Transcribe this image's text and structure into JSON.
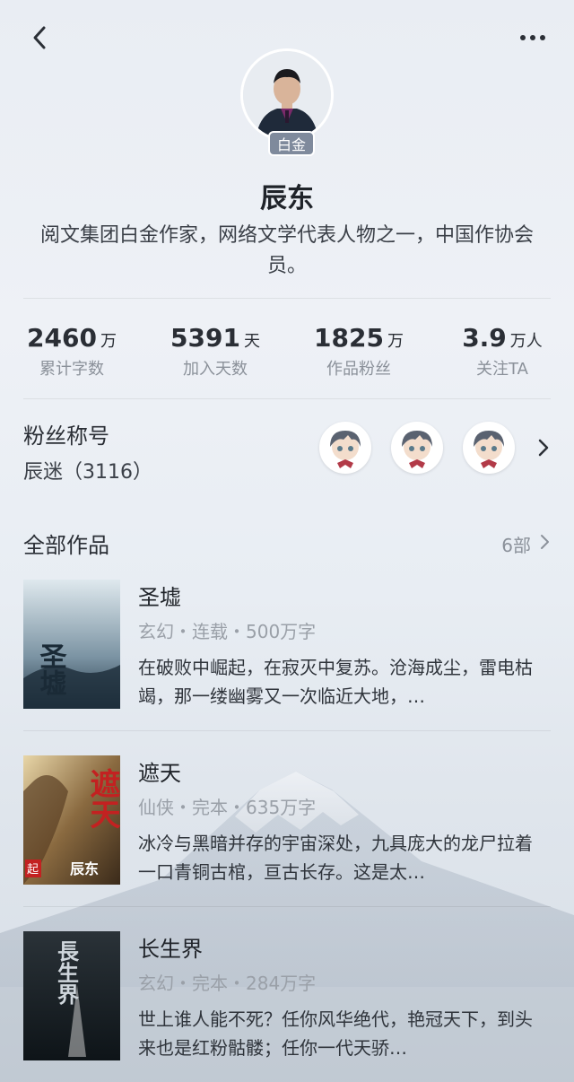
{
  "header": {
    "back_icon": "chevron-left-icon",
    "more_icon": "more-dots-icon"
  },
  "author": {
    "badge": "白金",
    "name": "辰东",
    "description": "阅文集团白金作家，网络文学代表人物之一，中国作协会员。"
  },
  "stats": [
    {
      "value": "2460",
      "unit": "万",
      "label": "累计字数"
    },
    {
      "value": "5391",
      "unit": "天",
      "label": "加入天数"
    },
    {
      "value": "1825",
      "unit": "万",
      "label": "作品粉丝"
    },
    {
      "value": "3.9",
      "unit": "万人",
      "label": "关注TA"
    }
  ],
  "fans": {
    "title": "粉丝称号",
    "subtitle": "辰迷（3116）"
  },
  "works": {
    "title": "全部作品",
    "count": "6部",
    "books": [
      {
        "title": "圣墟",
        "meta": "玄幻・连载・500万字",
        "desc": "在破败中崛起，在寂灭中复苏。沧海成尘，雷电枯竭，那一缕幽雾又一次临近大地，…",
        "cover_text": "圣墟"
      },
      {
        "title": "遮天",
        "meta": "仙侠・完本・635万字",
        "desc": "冰冷与黑暗并存的宇宙深处，九具庞大的龙尸拉着一口青铜古棺，亘古长存。这是太…",
        "cover_text": "遮天",
        "cover_author": "辰东",
        "cover_tag": "起"
      },
      {
        "title": "长生界",
        "meta": "玄幻・完本・284万字",
        "desc": "世上谁人能不死？任你风华绝代，艳冠天下，到头来也是红粉骷髅；任你一代天骄…",
        "cover_text": "長生界"
      }
    ]
  }
}
